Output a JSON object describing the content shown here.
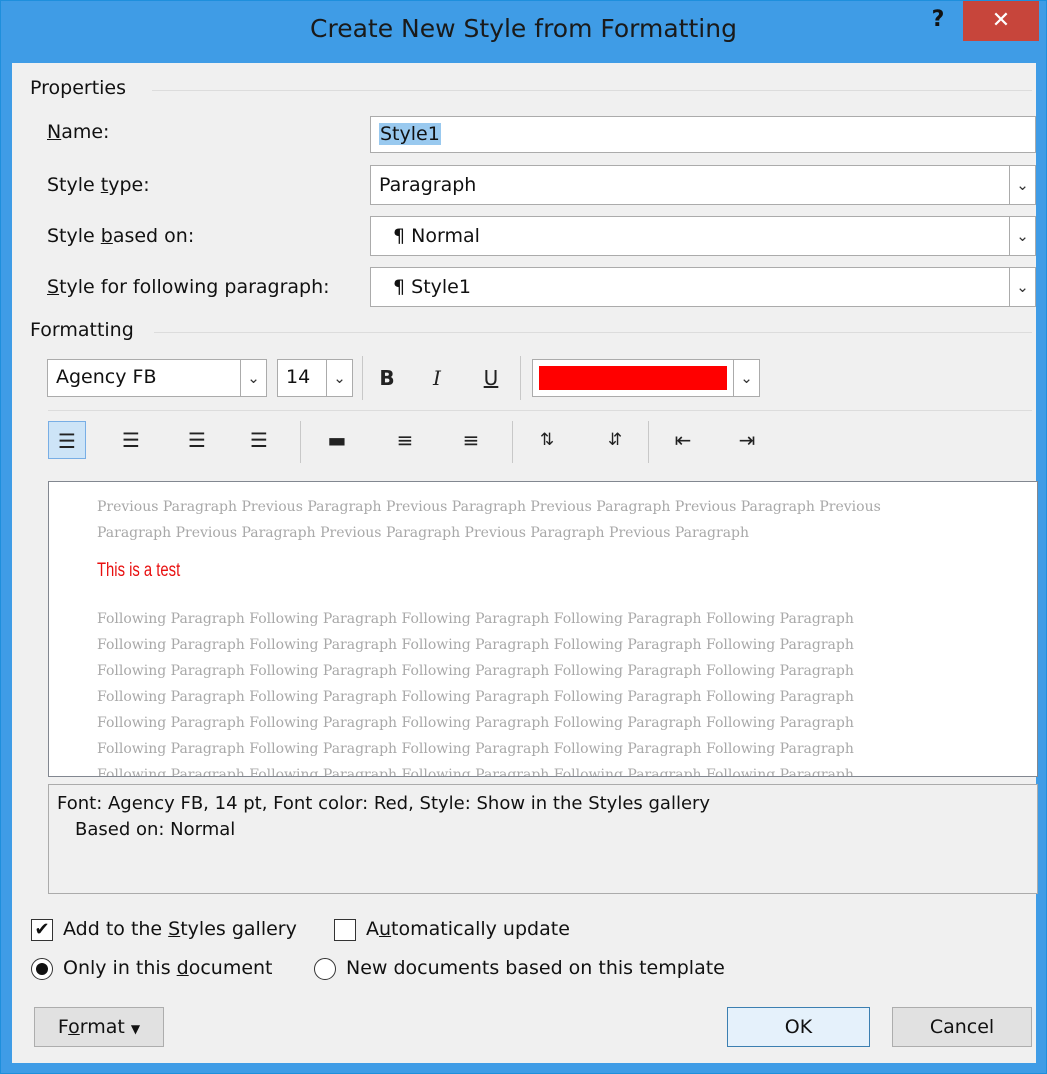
{
  "dialog": {
    "title": "Create New Style from Formatting",
    "help_label": "?",
    "close_label": "✕"
  },
  "properties": {
    "group_label": "Properties",
    "name": {
      "label": "Name:",
      "value": "Style1"
    },
    "style_type": {
      "label": "Style type:",
      "value": "Paragraph"
    },
    "style_based_on": {
      "label": "Style based on:",
      "value": "Normal"
    },
    "style_following": {
      "label": "Style for following paragraph:",
      "value": "Style1"
    },
    "paragraph_mark": "¶"
  },
  "formatting": {
    "group_label": "Formatting",
    "font_name": "Agency FB",
    "font_size": "14",
    "bold_label": "B",
    "italic_label": "I",
    "underline_label": "U",
    "font_color": "#ff0000"
  },
  "preview": {
    "previous_paragraph": "Previous Paragraph Previous Paragraph Previous Paragraph Previous Paragraph Previous Paragraph Previous Paragraph Previous Paragraph Previous Paragraph Previous Paragraph Previous Paragraph",
    "sample_text": "This is a test",
    "following_paragraph": "Following Paragraph Following Paragraph Following Paragraph Following Paragraph Following Paragraph Following Paragraph Following Paragraph Following Paragraph Following Paragraph Following Paragraph Following Paragraph Following Paragraph Following Paragraph Following Paragraph Following Paragraph Following Paragraph Following Paragraph Following Paragraph Following Paragraph Following Paragraph Following Paragraph Following Paragraph Following Paragraph Following Paragraph Following Paragraph Following Paragraph Following Paragraph Following Paragraph Following Paragraph Following Paragraph Following Paragraph Following Paragraph Following Paragraph Following Paragraph Following Paragraph"
  },
  "description": {
    "line1": "Font: Agency FB, 14 pt, Font color: Red, Style: Show in the Styles gallery",
    "line2": "Based on: Normal"
  },
  "options": {
    "add_to_gallery": {
      "label": "Add to the Styles gallery",
      "checked": true
    },
    "auto_update": {
      "label": "Automatically update",
      "checked": false
    },
    "only_this_document": {
      "label": "Only in this document",
      "selected": true
    },
    "new_documents": {
      "label": "New documents based on this template",
      "selected": false
    }
  },
  "buttons": {
    "format": "Format",
    "ok": "OK",
    "cancel": "Cancel"
  },
  "colors": {
    "title_bar": "#3f9ce6",
    "close_button": "#c7453b",
    "sample_text": "#e81010"
  }
}
